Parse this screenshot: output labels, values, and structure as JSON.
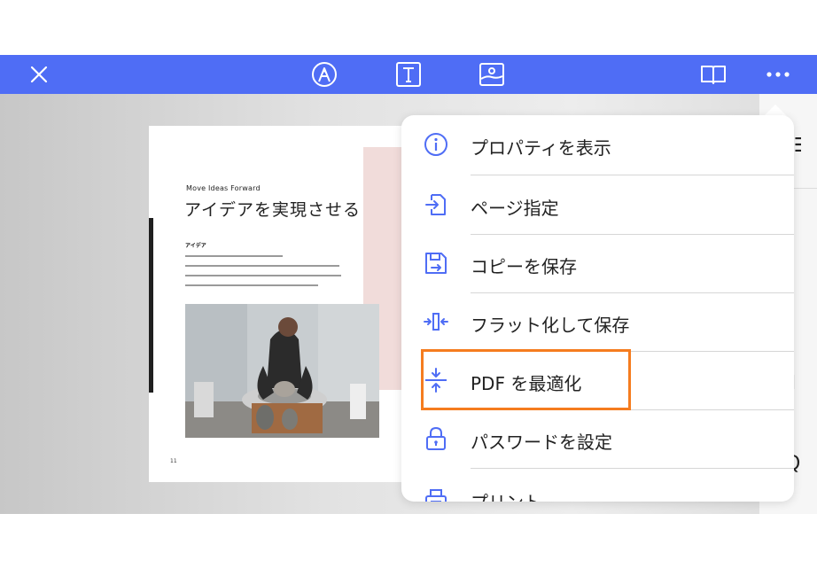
{
  "colors": {
    "toolbar": "#4f6df5",
    "accent_icon": "#4f6df5",
    "highlight_border": "#f57c1f"
  },
  "toolbar": {
    "close_icon": "close-icon",
    "pen_icon": "pen-icon",
    "text_icon": "text-icon",
    "image_icon": "image-icon",
    "book_icon": "book-icon",
    "more_icon": "more-icon"
  },
  "document_page": {
    "eyebrow": "Move Ideas Forward",
    "title": "アイデアを実現させる",
    "subheading": "アイデア",
    "page_number": "11"
  },
  "menu": {
    "items": [
      {
        "label": "プロパティを表示",
        "icon": "info-icon"
      },
      {
        "label": "ページ指定",
        "icon": "go-to-page-icon"
      },
      {
        "label": "コピーを保存",
        "icon": "save-copy-icon"
      },
      {
        "label": "フラット化して保存",
        "icon": "flatten-icon"
      },
      {
        "label": "PDF を最適化",
        "icon": "optimize-icon",
        "highlighted": true
      },
      {
        "label": "パスワードを設定",
        "icon": "lock-icon"
      },
      {
        "label": "プリント",
        "icon": "print-icon"
      }
    ]
  }
}
